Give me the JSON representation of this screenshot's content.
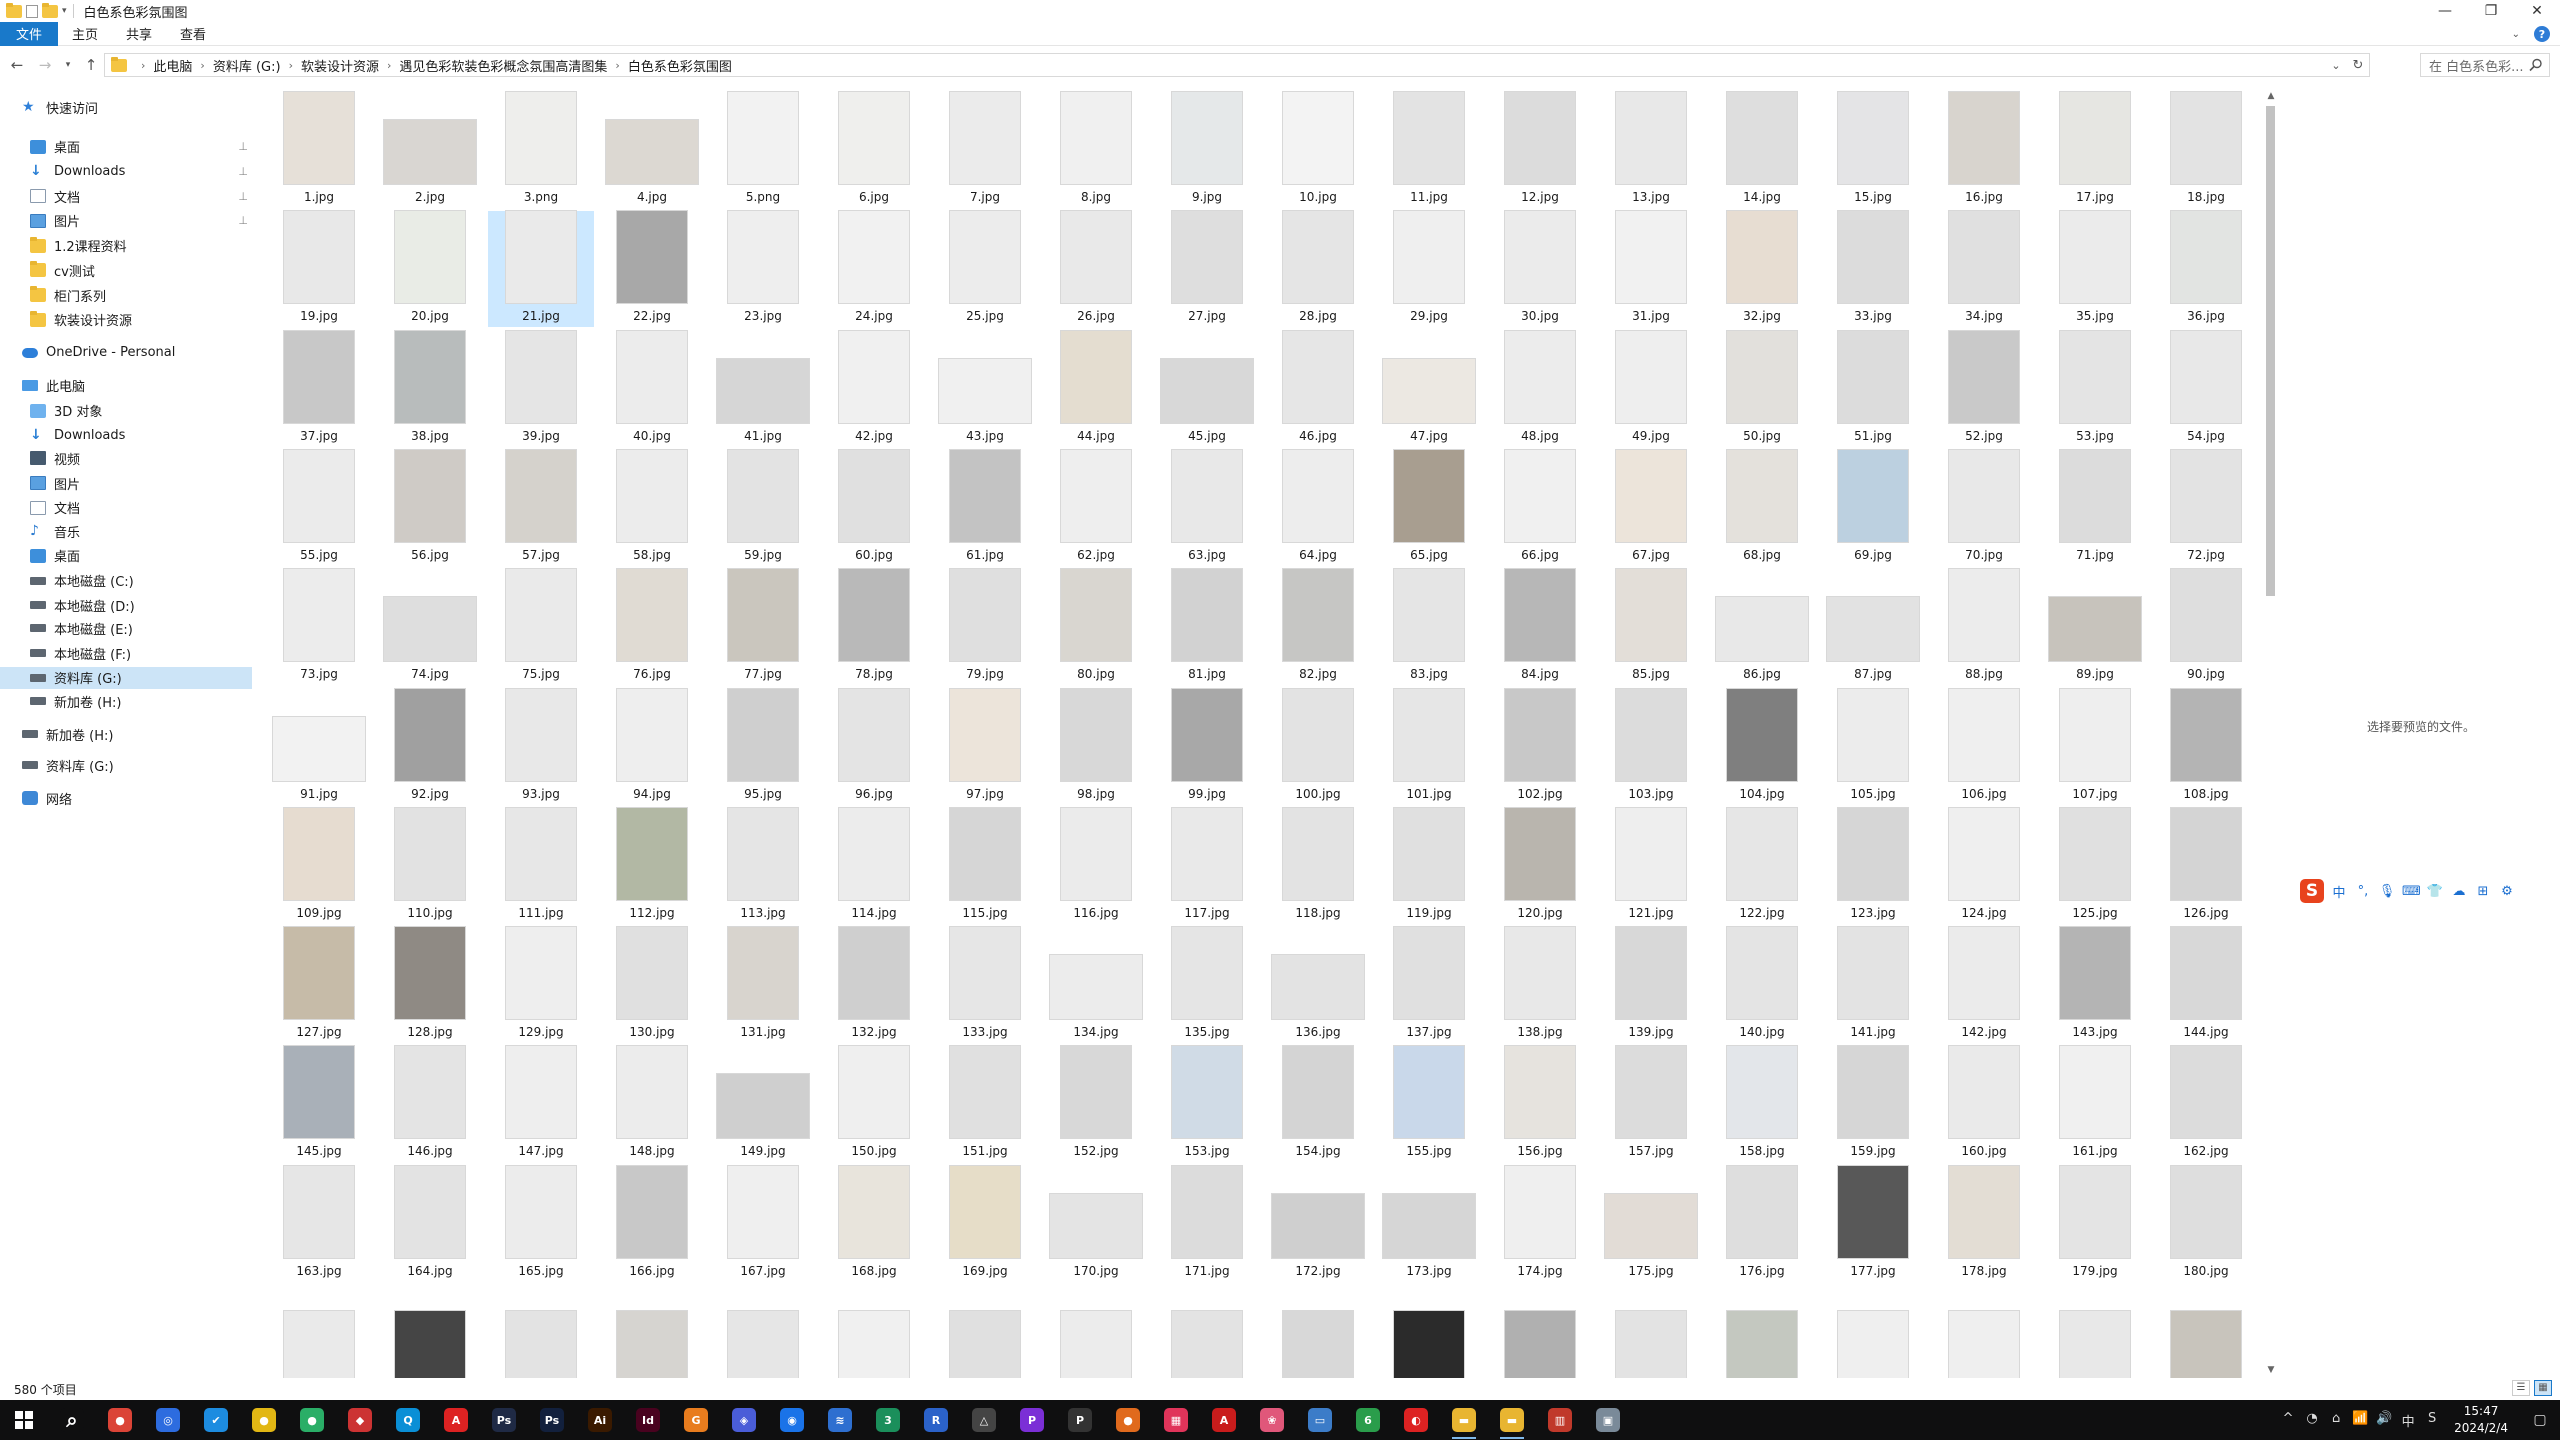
{
  "window": {
    "title": "白色系色彩氛围图",
    "controls": [
      "—",
      "❐",
      "✕"
    ]
  },
  "ribbon": {
    "tabs": [
      "文件",
      "主页",
      "共享",
      "查看"
    ],
    "help": "?"
  },
  "address": {
    "crumbs": [
      "此电脑",
      "资料库 (G:)",
      "软装设计资源",
      "遇见色彩软装色彩概念氛围高清图集",
      "白色系色彩氛围图"
    ]
  },
  "search": {
    "placeholder": "在 白色系色彩..."
  },
  "nav_pane": {
    "items": [
      {
        "label": "快速访问",
        "icon": "star-icon",
        "level": 0,
        "pinned": false
      },
      {
        "label": "桌面",
        "icon": "desktop-icon",
        "level": 1,
        "pinned": true
      },
      {
        "label": "Downloads",
        "icon": "download-icon",
        "level": 1,
        "pinned": true
      },
      {
        "label": "文档",
        "icon": "document-icon",
        "level": 1,
        "pinned": true
      },
      {
        "label": "图片",
        "icon": "picture-icon",
        "level": 1,
        "pinned": true
      },
      {
        "label": "1.2课程资料",
        "icon": "folder-icon",
        "level": 1,
        "pinned": false
      },
      {
        "label": "cv测试",
        "icon": "folder-icon",
        "level": 1,
        "pinned": false
      },
      {
        "label": "柜门系列",
        "icon": "folder-icon",
        "level": 1,
        "pinned": false
      },
      {
        "label": "软装设计资源",
        "icon": "folder-icon",
        "level": 1,
        "pinned": false
      },
      {
        "label": "OneDrive - Personal",
        "icon": "cloud-icon",
        "level": 0,
        "pinned": false
      },
      {
        "label": "此电脑",
        "icon": "computer-icon",
        "level": 0,
        "pinned": false
      },
      {
        "label": "3D 对象",
        "icon": "3d-objects-icon",
        "level": 1,
        "pinned": false
      },
      {
        "label": "Downloads",
        "icon": "download-icon",
        "level": 1,
        "pinned": false
      },
      {
        "label": "视频",
        "icon": "video-icon",
        "level": 1,
        "pinned": false
      },
      {
        "label": "图片",
        "icon": "picture-icon",
        "level": 1,
        "pinned": false
      },
      {
        "label": "文档",
        "icon": "document-icon",
        "level": 1,
        "pinned": false
      },
      {
        "label": "音乐",
        "icon": "music-icon",
        "level": 1,
        "pinned": false
      },
      {
        "label": "桌面",
        "icon": "desktop-icon",
        "level": 1,
        "pinned": false
      },
      {
        "label": "本地磁盘 (C:)",
        "icon": "drive-icon",
        "level": 1,
        "pinned": false
      },
      {
        "label": "本地磁盘 (D:)",
        "icon": "drive-icon",
        "level": 1,
        "pinned": false
      },
      {
        "label": "本地磁盘 (E:)",
        "icon": "drive-icon",
        "level": 1,
        "pinned": false
      },
      {
        "label": "本地磁盘 (F:)",
        "icon": "drive-icon",
        "level": 1,
        "pinned": false
      },
      {
        "label": "资料库 (G:)",
        "icon": "drive-icon",
        "level": 1,
        "pinned": false,
        "selected": true
      },
      {
        "label": "新加卷 (H:)",
        "icon": "drive-icon",
        "level": 1,
        "pinned": false
      },
      {
        "label": "新加卷 (H:)",
        "icon": "drive-icon",
        "level": 0,
        "pinned": false
      },
      {
        "label": "资料库 (G:)",
        "icon": "drive-icon",
        "level": 0,
        "pinned": false
      },
      {
        "label": "网络",
        "icon": "network-icon",
        "level": 0,
        "pinned": false
      }
    ]
  },
  "files": {
    "names": [
      "1.jpg",
      "2.jpg",
      "3.png",
      "4.jpg",
      "5.png",
      "6.jpg",
      "7.jpg",
      "8.jpg",
      "9.jpg",
      "10.jpg",
      "11.jpg",
      "12.jpg",
      "13.jpg",
      "14.jpg",
      "15.jpg",
      "16.jpg",
      "17.jpg",
      "18.jpg",
      "19.jpg",
      "20.jpg",
      "21.jpg",
      "22.jpg",
      "23.jpg",
      "24.jpg",
      "25.jpg",
      "26.jpg",
      "27.jpg",
      "28.jpg",
      "29.jpg",
      "30.jpg",
      "31.jpg",
      "32.jpg",
      "33.jpg",
      "34.jpg",
      "35.jpg",
      "36.jpg",
      "37.jpg",
      "38.jpg",
      "39.jpg",
      "40.jpg",
      "41.jpg",
      "42.jpg",
      "43.jpg",
      "44.jpg",
      "45.jpg",
      "46.jpg",
      "47.jpg",
      "48.jpg",
      "49.jpg",
      "50.jpg",
      "51.jpg",
      "52.jpg",
      "53.jpg",
      "54.jpg",
      "55.jpg",
      "56.jpg",
      "57.jpg",
      "58.jpg",
      "59.jpg",
      "60.jpg",
      "61.jpg",
      "62.jpg",
      "63.jpg",
      "64.jpg",
      "65.jpg",
      "66.jpg",
      "67.jpg",
      "68.jpg",
      "69.jpg",
      "70.jpg",
      "71.jpg",
      "72.jpg",
      "73.jpg",
      "74.jpg",
      "75.jpg",
      "76.jpg",
      "77.jpg",
      "78.jpg",
      "79.jpg",
      "80.jpg",
      "81.jpg",
      "82.jpg",
      "83.jpg",
      "84.jpg",
      "85.jpg",
      "86.jpg",
      "87.jpg",
      "88.jpg",
      "89.jpg",
      "90.jpg",
      "91.jpg",
      "92.jpg",
      "93.jpg",
      "94.jpg",
      "95.jpg",
      "96.jpg",
      "97.jpg",
      "98.jpg",
      "99.jpg",
      "100.jpg",
      "101.jpg",
      "102.jpg",
      "103.jpg",
      "104.jpg",
      "105.jpg",
      "106.jpg",
      "107.jpg",
      "108.jpg",
      "109.jpg",
      "110.jpg",
      "111.jpg",
      "112.jpg",
      "113.jpg",
      "114.jpg",
      "115.jpg",
      "116.jpg",
      "117.jpg",
      "118.jpg",
      "119.jpg",
      "120.jpg",
      "121.jpg",
      "122.jpg",
      "123.jpg",
      "124.jpg",
      "125.jpg",
      "126.jpg",
      "127.jpg",
      "128.jpg",
      "129.jpg",
      "130.jpg",
      "131.jpg",
      "132.jpg",
      "133.jpg",
      "134.jpg",
      "135.jpg",
      "136.jpg",
      "137.jpg",
      "138.jpg",
      "139.jpg",
      "140.jpg",
      "141.jpg",
      "142.jpg",
      "143.jpg",
      "144.jpg",
      "145.jpg",
      "146.jpg",
      "147.jpg",
      "148.jpg",
      "149.jpg",
      "150.jpg",
      "151.jpg",
      "152.jpg",
      "153.jpg",
      "154.jpg",
      "155.jpg",
      "156.jpg",
      "157.jpg",
      "158.jpg",
      "159.jpg",
      "160.jpg",
      "161.jpg",
      "162.jpg",
      "163.jpg",
      "164.jpg",
      "165.jpg",
      "166.jpg",
      "167.jpg",
      "168.jpg",
      "169.jpg",
      "170.jpg",
      "171.jpg",
      "172.jpg",
      "173.jpg",
      "174.jpg",
      "175.jpg",
      "176.jpg",
      "177.jpg",
      "178.jpg",
      "179.jpg",
      "180.jpg",
      "",
      "",
      "",
      "",
      "",
      "",
      "",
      "",
      "",
      "",
      "",
      "",
      "",
      "",
      "",
      "",
      "",
      ""
    ],
    "selected": "21.jpg",
    "orientation": [
      "p",
      "l",
      "p",
      "l",
      "p",
      "p",
      "p",
      "p",
      "p",
      "p",
      "p",
      "p",
      "p",
      "p",
      "p",
      "p",
      "p",
      "p",
      "p",
      "p",
      "p",
      "p",
      "p",
      "p",
      "p",
      "p",
      "p",
      "p",
      "p",
      "p",
      "p",
      "p",
      "p",
      "p",
      "p",
      "p",
      "p",
      "p",
      "p",
      "p",
      "l",
      "p",
      "l",
      "p",
      "l",
      "p",
      "l",
      "p",
      "p",
      "p",
      "p",
      "p",
      "p",
      "p",
      "p",
      "p",
      "p",
      "p",
      "p",
      "p",
      "p",
      "p",
      "p",
      "p",
      "p",
      "p",
      "p",
      "p",
      "p",
      "p",
      "p",
      "p",
      "p",
      "l",
      "p",
      "p",
      "p",
      "p",
      "p",
      "p",
      "p",
      "p",
      "p",
      "p",
      "p",
      "l",
      "l",
      "p",
      "l",
      "p",
      "l",
      "p",
      "p",
      "p",
      "p",
      "p",
      "p",
      "p",
      "p",
      "p",
      "p",
      "p",
      "p",
      "p",
      "p",
      "p",
      "p",
      "p",
      "p",
      "p",
      "p",
      "p",
      "p",
      "p",
      "p",
      "p",
      "p",
      "p",
      "p",
      "p",
      "p",
      "p",
      "p",
      "p",
      "p",
      "p",
      "p",
      "p",
      "p",
      "p",
      "p",
      "p",
      "p",
      "l",
      "p",
      "l",
      "p",
      "p",
      "p",
      "p",
      "p",
      "p",
      "p",
      "p",
      "p",
      "p",
      "p",
      "p",
      "l",
      "p",
      "p",
      "p",
      "p",
      "p",
      "p",
      "p",
      "p",
      "p",
      "p",
      "p",
      "p",
      "p",
      "p",
      "p",
      "p",
      "p",
      "p",
      "p",
      "p",
      "l",
      "p",
      "l",
      "l",
      "p",
      "l",
      "p",
      "p",
      "p",
      "p",
      "p",
      "p",
      "p",
      "p",
      "p",
      "p",
      "p",
      "p",
      "p",
      "p",
      "p",
      "p",
      "p",
      "p",
      "p",
      "p",
      "p",
      "p",
      "p"
    ],
    "tones": [
      "#e6e0d8",
      "#d9d6d2",
      "#eeeeec",
      "#dcd8d2",
      "#f2f2f2",
      "#efefed",
      "#ebebeb",
      "#f0f0f0",
      "#e5e8e9",
      "#f3f3f3",
      "#e3e3e3",
      "#dcdcdc",
      "#e8e8e8",
      "#dedede",
      "#e4e4e6",
      "#d8d4ce",
      "#e6e6e2",
      "#e3e3e3",
      "#e8e8e8",
      "#e9ece6",
      "#eaeaea",
      "#a8a8a8",
      "#eeeeee",
      "#f1f1f1",
      "#ececec",
      "#e9e9e9",
      "#dedede",
      "#e5e5e5",
      "#efefef",
      "#ebebeb",
      "#f1f1f1",
      "#e7ddd2",
      "#dcdcdc",
      "#e0e0e0",
      "#ebebeb",
      "#e2e4e2",
      "#c8c8c8",
      "#b8bcbc",
      "#e5e5e5",
      "#ececec",
      "#d6d6d6",
      "#f0f0f0",
      "#f0f0f0",
      "#e4ddd0",
      "#d8d8d8",
      "#e6e6e6",
      "#ece8e2",
      "#ececec",
      "#eeeeee",
      "#e2e0dc",
      "#dcdcdc",
      "#c9c9c9",
      "#e4e4e4",
      "#e8e8e8",
      "#ebebeb",
      "#cfcbc6",
      "#d5d2cc",
      "#ececec",
      "#e3e3e3",
      "#e0e0e0",
      "#c3c3c3",
      "#eeeeee",
      "#e8e8e8",
      "#ededed",
      "#a89e90",
      "#f0f0f0",
      "#ece4da",
      "#e4e1dc",
      "#bcd0e0",
      "#e8e8e8",
      "#dcdcdc",
      "#e3e3e3",
      "#ececec",
      "#dedede",
      "#eaeaea",
      "#e0dbd3",
      "#cac6be",
      "#b9b9b9",
      "#dfdfdf",
      "#d9d6d0",
      "#d2d2d2",
      "#c6c6c4",
      "#e5e5e5",
      "#b7b7b7",
      "#e3ded8",
      "#e8e8e8",
      "#e2e2e2",
      "#ececec",
      "#c7c3bc",
      "#dedede",
      "#f2f2f2",
      "#a0a0a0",
      "#e8e8e8",
      "#eeeeee",
      "#cfcfcf",
      "#e4e4e4",
      "#ece4da",
      "#d8d8d8",
      "#a8a8a8",
      "#e3e3e3",
      "#e6e6e6",
      "#c8c8c8",
      "#dcdcdc",
      "#7f7f7f",
      "#ececec",
      "#efefef",
      "#eeeeee",
      "#b4b4b4",
      "#e6dcd0",
      "#e2e2e2",
      "#e7e7e7",
      "#b2b8a4",
      "#e5e5e5",
      "#ececec",
      "#d6d6d6",
      "#ebebeb",
      "#e9e9e9",
      "#e3e3e3",
      "#e0e0e0",
      "#b9b5ae",
      "#eeeeee",
      "#e6e6e6",
      "#d6d6d6",
      "#efefef",
      "#e0e0e0",
      "#d4d4d4",
      "#c6bba8",
      "#8f8a84",
      "#eeeeee",
      "#e0e0e0",
      "#d8d4ce",
      "#cfcfcf",
      "#e6e6e6",
      "#ececec",
      "#e5e5e5",
      "#e3e3e3",
      "#e0e0e0",
      "#e8e8e8",
      "#d8d8d8",
      "#e4e4e4",
      "#e3e3e3",
      "#ebebeb",
      "#b4b4b4",
      "#d8d8d8",
      "#a9b0b8",
      "#e4e4e4",
      "#eeeeee",
      "#ececec",
      "#cfcfcf",
      "#efefef",
      "#e0e0e0",
      "#d8d8d8",
      "#d0dbe6",
      "#d4d4d4",
      "#c9d8ea",
      "#e6e3de",
      "#dcdcdc",
      "#e3e6ea",
      "#d6d6d6",
      "#eaeaea",
      "#f0f0f0",
      "#dcdcdc",
      "#e6e6e6",
      "#e3e3e3",
      "#ececec",
      "#c8c8c8",
      "#efefef",
      "#e8e4dc",
      "#e6ddc8",
      "#e4e4e4",
      "#dcdcdc",
      "#cfcfcf",
      "#d6d6d6",
      "#efefef",
      "#e2dcd6",
      "#dedede",
      "#585858",
      "#e3ddd4",
      "#e4e4e4",
      "#dedede",
      "#eaeaea",
      "#454545",
      "#e3e3e3",
      "#d6d4d0",
      "#e6e6e6",
      "#f0f0f0",
      "#e0e0e0",
      "#ececec",
      "#e3e3e3",
      "#d8d8d8",
      "#2b2b2b",
      "#b0b0b0",
      "#e3e3e3",
      "#c4c8c0",
      "#efefef",
      "#efefef",
      "#e8e8e8",
      "#c8c4bc"
    ]
  },
  "preview": {
    "message": "选择要预览的文件。"
  },
  "ime": {
    "items": [
      "中",
      "°,",
      "🎙",
      "⌨",
      "👕",
      "☁",
      "⊞",
      "⚙"
    ]
  },
  "status": {
    "count": "580 个项目"
  },
  "taskbar": {
    "apps": [
      {
        "name": "search",
        "glyph": "⌕",
        "color": "#0f0f10"
      },
      {
        "name": "chrome",
        "glyph": "●",
        "color": "#db4437"
      },
      {
        "name": "app-blue",
        "glyph": "◎",
        "color": "#2d6cdf"
      },
      {
        "name": "app-bird",
        "glyph": "✔",
        "color": "#1d8ce0"
      },
      {
        "name": "app-yellow",
        "glyph": "●",
        "color": "#e2b714"
      },
      {
        "name": "wechat",
        "glyph": "●",
        "color": "#2aae67"
      },
      {
        "name": "app-red",
        "glyph": "◆",
        "color": "#c33"
      },
      {
        "name": "app-cyan",
        "glyph": "Q",
        "color": "#0a8fd6"
      },
      {
        "name": "acrobat",
        "glyph": "A",
        "color": "#d22"
      },
      {
        "name": "photoshop",
        "glyph": "Ps",
        "color": "#1f2a45"
      },
      {
        "name": "photoshop2",
        "glyph": "Ps",
        "color": "#12203d"
      },
      {
        "name": "illustrator",
        "glyph": "Ai",
        "color": "#3a1a00"
      },
      {
        "name": "indesign",
        "glyph": "Id",
        "color": "#49021f"
      },
      {
        "name": "app-g",
        "glyph": "G",
        "color": "#e87c1e"
      },
      {
        "name": "app-shield",
        "glyph": "◈",
        "color": "#4a5dd8"
      },
      {
        "name": "app-globe",
        "glyph": "◉",
        "color": "#1a73e8"
      },
      {
        "name": "app-layers",
        "glyph": "≋",
        "color": "#2e6fd0"
      },
      {
        "name": "app-3",
        "glyph": "3",
        "color": "#1b8f5b"
      },
      {
        "name": "app-r",
        "glyph": "R",
        "color": "#2b62c9"
      },
      {
        "name": "app-sketch",
        "glyph": "△",
        "color": "#444"
      },
      {
        "name": "app-p",
        "glyph": "P",
        "color": "#7b2fd6"
      },
      {
        "name": "app-p2",
        "glyph": "P",
        "color": "#333"
      },
      {
        "name": "app-ball",
        "glyph": "●",
        "color": "#e06a1d"
      },
      {
        "name": "app-grid",
        "glyph": "▦",
        "color": "#e0345a"
      },
      {
        "name": "app-a",
        "glyph": "A",
        "color": "#c91c1c"
      },
      {
        "name": "app-pink",
        "glyph": "❀",
        "color": "#e0577a"
      },
      {
        "name": "app-desk",
        "glyph": "▭",
        "color": "#3c7cc8"
      },
      {
        "name": "app-6",
        "glyph": "6",
        "color": "#2a9d4b"
      },
      {
        "name": "app-fire",
        "glyph": "◐",
        "color": "#d22"
      },
      {
        "name": "file-explorer",
        "glyph": "▬",
        "color": "#e8b531"
      },
      {
        "name": "file-explorer-2",
        "glyph": "▬",
        "color": "#e8b531"
      },
      {
        "name": "app-chart",
        "glyph": "▥",
        "color": "#c0392b"
      },
      {
        "name": "app-box",
        "glyph": "▣",
        "color": "#7a8a99"
      }
    ],
    "active_indices": [
      29,
      30
    ],
    "tray": [
      "^",
      "◔",
      "⌂",
      "📶",
      "🔊",
      "中",
      "S"
    ],
    "time": "15:47",
    "date": "2024/2/4",
    "notification": "▢"
  }
}
